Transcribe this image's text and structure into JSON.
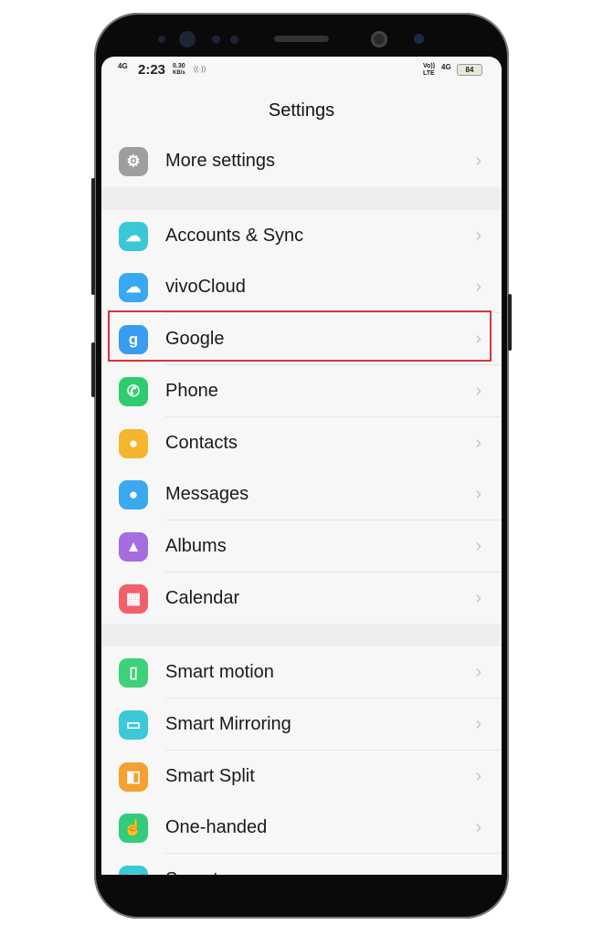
{
  "status_bar": {
    "network": "4G",
    "time": "2:23",
    "speed": "0.30",
    "speed_unit": "KB/s",
    "volte": "Vo)) LTE",
    "network_right": "4G",
    "battery": "84"
  },
  "header": {
    "title": "Settings"
  },
  "sections": [
    [
      {
        "label": "More settings",
        "icon": "gear-icon",
        "color": "#9e9e9e"
      }
    ],
    [
      {
        "label": "Accounts & Sync",
        "icon": "cloud-sync-icon",
        "color": "#3cc7d6"
      },
      {
        "label": "vivoCloud",
        "icon": "cloud-icon",
        "color": "#39a8f0"
      },
      {
        "label": "Google",
        "icon": "google-icon",
        "color": "#3a9cf0",
        "highlighted": true
      },
      {
        "label": "Phone",
        "icon": "phone-icon",
        "color": "#2ecc71"
      },
      {
        "label": "Contacts",
        "icon": "contact-icon",
        "color": "#f5b52e"
      },
      {
        "label": "Messages",
        "icon": "message-icon",
        "color": "#3ba9f0"
      },
      {
        "label": "Albums",
        "icon": "image-icon",
        "color": "#a56de0"
      },
      {
        "label": "Calendar",
        "icon": "calendar-icon",
        "color": "#f0616a"
      }
    ],
    [
      {
        "label": "Smart motion",
        "icon": "smart-motion-icon",
        "color": "#3dd17a"
      },
      {
        "label": "Smart Mirroring",
        "icon": "mirroring-icon",
        "color": "#3cc8d8"
      },
      {
        "label": "Smart Split",
        "icon": "split-icon",
        "color": "#f5a030"
      },
      {
        "label": "One-handed",
        "icon": "hand-icon",
        "color": "#34cc7a"
      },
      {
        "label": "S-capture",
        "icon": "screenshot-icon",
        "color": "#3cc8d8"
      }
    ]
  ],
  "glyphs": {
    "gear-icon": "⚙",
    "cloud-sync-icon": "☁",
    "cloud-icon": "☁",
    "google-icon": "g",
    "phone-icon": "✆",
    "contact-icon": "●",
    "message-icon": "●",
    "image-icon": "▲",
    "calendar-icon": "▦",
    "smart-motion-icon": "▯",
    "mirroring-icon": "▭",
    "split-icon": "◧",
    "hand-icon": "☝",
    "screenshot-icon": "▣"
  },
  "chevron": "›"
}
